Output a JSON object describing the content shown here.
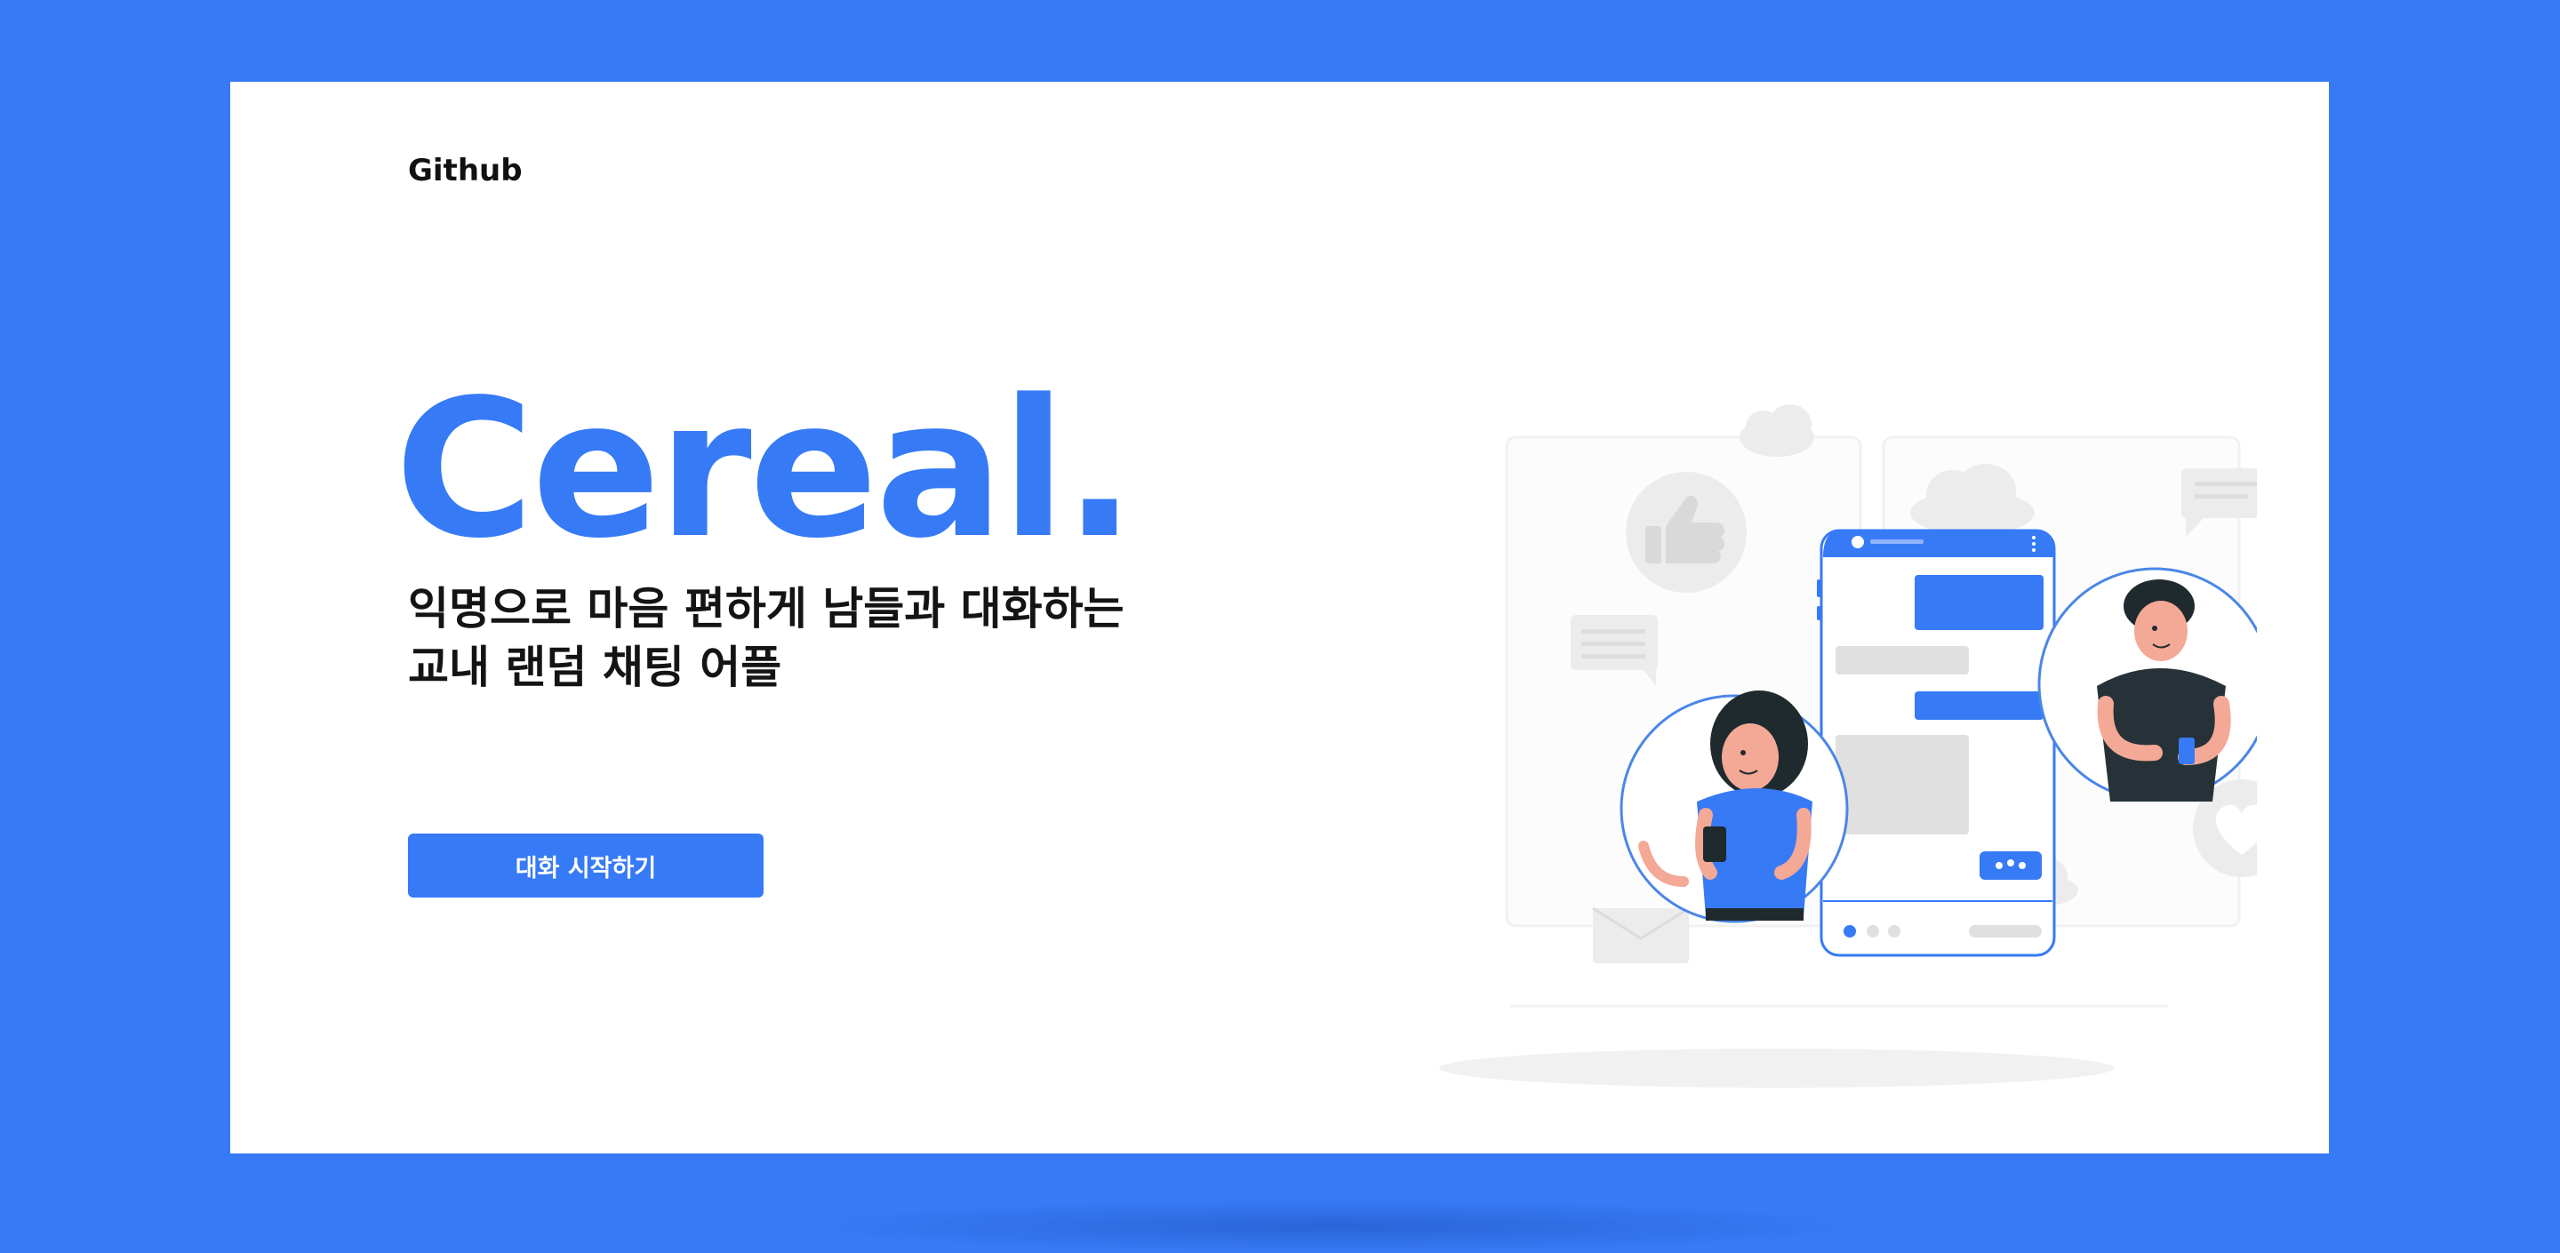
{
  "header": {
    "github_label": "Github"
  },
  "hero": {
    "title": "Cereal.",
    "tagline_lines": [
      "익명으로 마음 편하게 남들과 대화하는",
      "교내 랜덤 채팅 어플"
    ],
    "cta_label": "대화 시작하기"
  },
  "colors": {
    "brand": "#367af6",
    "background": "#ffffff",
    "text": "#141414",
    "placeholder_gray": "#e0e0e0"
  },
  "illustration": {
    "icons": [
      "thumbs-up-icon",
      "chat-bubble-icon",
      "heart-icon",
      "envelope-icon",
      "cloud-icon"
    ]
  }
}
